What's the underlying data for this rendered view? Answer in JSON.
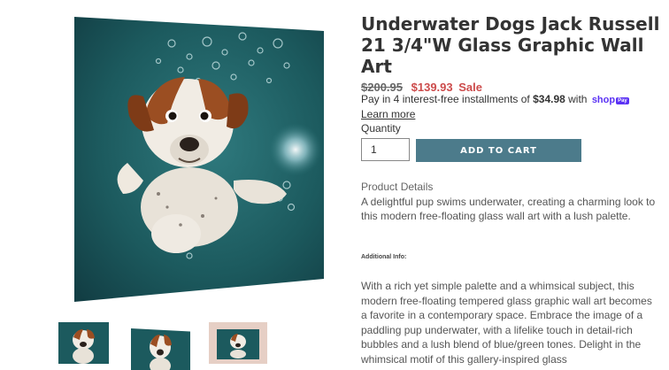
{
  "product": {
    "title": "Underwater Dogs Jack Russell 21 3/4\"W Glass Graphic Wall Art",
    "price_compare": "$200.95",
    "price_sale": "$139.93",
    "sale_label": "Sale"
  },
  "installments": {
    "text_before": "Pay in 4 interest-free installments of ",
    "amount": "$34.98",
    "text_after": " with ",
    "brand": "shop",
    "brand_badge": "Pay",
    "learn_more": "Learn more"
  },
  "purchase": {
    "quantity_label": "Quantity",
    "quantity_value": "1",
    "add_to_cart_label": "ADD TO CART",
    "button_color": "#4c7b8b"
  },
  "details": {
    "heading": "Product Details",
    "text": "A delightful pup swims underwater, creating a charming look to this modern free-floating glass wall art with a lush palette.",
    "additional_heading": "Additional Info:",
    "additional_text": "With a rich yet simple palette and a whimsical subject, this modern free-floating tempered glass graphic wall art becomes a favorite in a contemporary space. Embrace the image of a paddling pup underwater, with a lifelike touch in detail-rich bubbles and a lush blend of blue/green tones. Delight in the whimsical motif of this gallery-inspired glass"
  },
  "colors": {
    "sale": "#cc4b4b",
    "water": "#1c5a5e",
    "shoppay": "#5a31f4"
  },
  "gallery": {
    "main_image_icon": "underwater-dog-photo",
    "thumbnails": [
      "thumb-front",
      "thumb-angle",
      "thumb-room"
    ]
  }
}
